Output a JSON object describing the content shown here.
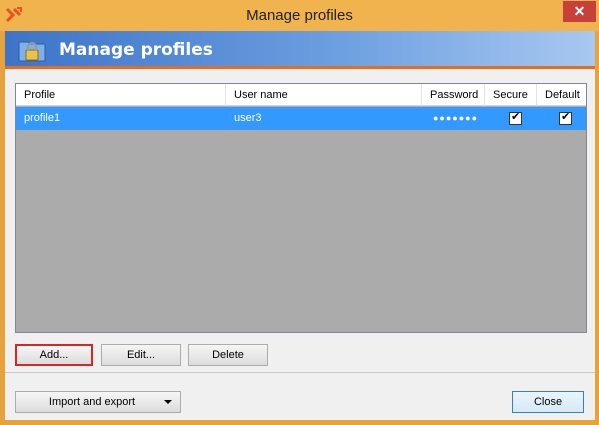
{
  "window": {
    "title": "Manage profiles",
    "close_label": "✕"
  },
  "header": {
    "title": "Manage profiles"
  },
  "list": {
    "columns": [
      "Profile",
      "User name",
      "Password",
      "Secure",
      "Default"
    ],
    "rows": [
      {
        "profile": "profile1",
        "user": "user3",
        "password": "●●●●●●●",
        "secure": true,
        "default": true
      }
    ]
  },
  "buttons": {
    "add": "Add...",
    "edit": "Edit...",
    "delete": "Delete",
    "import_export": "Import and export",
    "close": "Close"
  },
  "colors": {
    "accent_orange": "#e86c1e",
    "selection_blue": "#3399ff",
    "header_blue": "#3d74c8"
  }
}
